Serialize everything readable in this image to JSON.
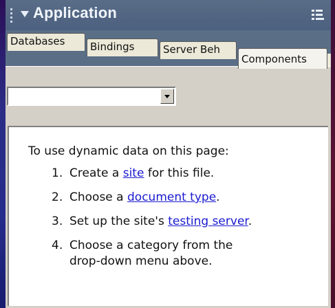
{
  "panel": {
    "title": "Application",
    "collapse_icon": "triangle-down-icon",
    "grip_icon": "grip-dots-icon",
    "options_icon": "panel-options-menu-icon"
  },
  "tabs": [
    {
      "label": "Databases",
      "active": false
    },
    {
      "label": "Bindings",
      "active": false
    },
    {
      "label": "Server Beh",
      "active": false
    },
    {
      "label": "Components",
      "active": true
    }
  ],
  "dropdown": {
    "value": "",
    "button_icon": "chevron-down-icon"
  },
  "instructions": {
    "intro": "To use dynamic data on this page:",
    "steps": [
      {
        "num": "1.",
        "before": "Create a ",
        "link": "site",
        "after": " for this file."
      },
      {
        "num": "2.",
        "before": "Choose a ",
        "link": "document type",
        "after": "."
      },
      {
        "num": "3.",
        "before": "Set up the site's ",
        "link": "testing server",
        "after": "."
      },
      {
        "num": "4.",
        "line1": "Choose a category from the",
        "line2": "drop-down menu above."
      }
    ]
  },
  "colors": {
    "header_bg": "#596d87",
    "panel_bg": "#d4d0c8",
    "link": "#1a1ad0",
    "tab_bg": "#ece9d8"
  }
}
